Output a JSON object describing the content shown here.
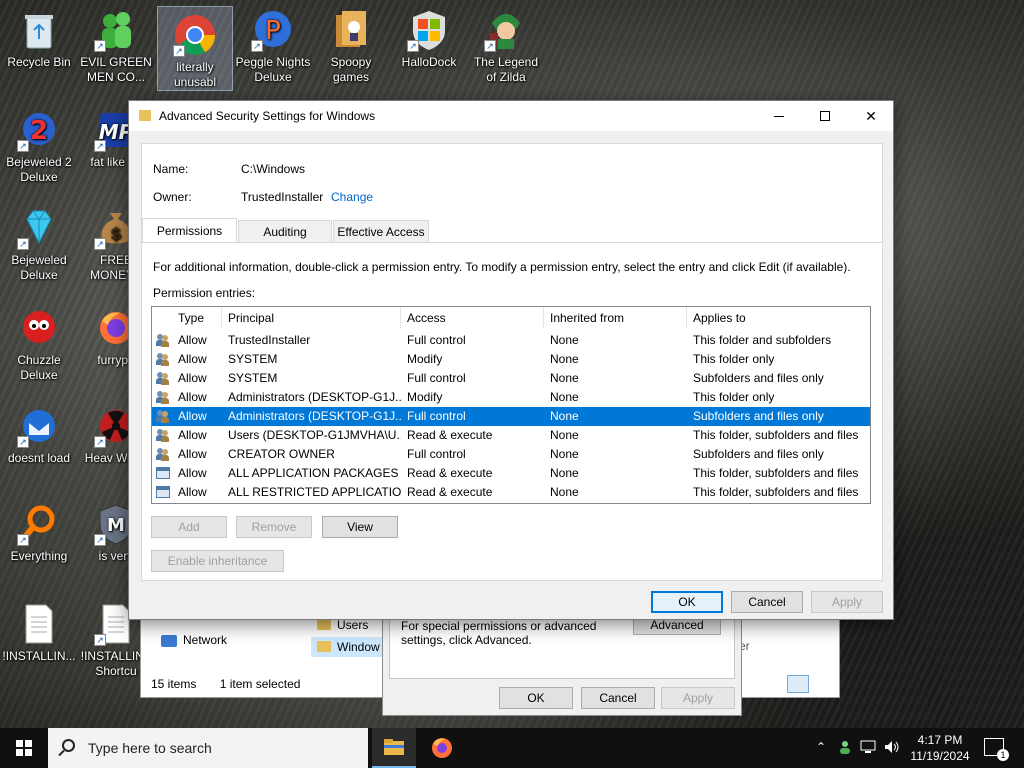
{
  "desktop": {
    "icons": [
      {
        "label": "Recycle Bin"
      },
      {
        "label": "EVIL GREEN MEN CO..."
      },
      {
        "label": "literally unusabl"
      },
      {
        "label": "Peggle Nights Deluxe"
      },
      {
        "label": "Spoopy games"
      },
      {
        "label": "HalloDock"
      },
      {
        "label": "The Legend of Zilda"
      },
      {
        "label": "Bejeweled 2 Deluxe"
      },
      {
        "label": "fat like da"
      },
      {
        "label": "Bejeweled Deluxe"
      },
      {
        "label": "FREE MONEY.c"
      },
      {
        "label": "Chuzzle Deluxe"
      },
      {
        "label": "furrypo"
      },
      {
        "label": "doesnt load"
      },
      {
        "label": "Heav Weap"
      },
      {
        "label": "Everything"
      },
      {
        "label": "is very"
      },
      {
        "label": "!INSTALLIN..."
      },
      {
        "label": "!INSTALLIN - Shortcu"
      }
    ]
  },
  "explorer": {
    "nav_network": "Network",
    "rows": [
      "Users",
      "Window"
    ],
    "status_items": "15 items",
    "status_selected": "1 item selected",
    "partial_text": "er"
  },
  "dialog2": {
    "note": "For special permissions or advanced settings, click Advanced.",
    "advanced_label": "Advanced",
    "ok_label": "OK",
    "cancel_label": "Cancel",
    "apply_label": "Apply"
  },
  "main": {
    "title": "Advanced Security Settings for Windows",
    "name_label": "Name:",
    "name_value": "C:\\Windows",
    "owner_label": "Owner:",
    "owner_value": "TrustedInstaller",
    "change_label": "Change",
    "tabs": [
      {
        "label": "Permissions"
      },
      {
        "label": "Auditing"
      },
      {
        "label": "Effective Access"
      }
    ],
    "hint": "For additional information, double-click a permission entry. To modify a permission entry, select the entry and click Edit (if available).",
    "entries_label": "Permission entries:",
    "columns": {
      "type": "Type",
      "principal": "Principal",
      "access": "Access",
      "inherited": "Inherited from",
      "applies": "Applies to"
    },
    "rows": [
      {
        "type": "Allow",
        "principal": "TrustedInstaller",
        "access": "Full control",
        "inherited": "None",
        "applies": "This folder and subfolders"
      },
      {
        "type": "Allow",
        "principal": "SYSTEM",
        "access": "Modify",
        "inherited": "None",
        "applies": "This folder only"
      },
      {
        "type": "Allow",
        "principal": "SYSTEM",
        "access": "Full control",
        "inherited": "None",
        "applies": "Subfolders and files only"
      },
      {
        "type": "Allow",
        "principal": "Administrators (DESKTOP-G1J...",
        "access": "Modify",
        "inherited": "None",
        "applies": "This folder only"
      },
      {
        "type": "Allow",
        "principal": "Administrators (DESKTOP-G1J...",
        "access": "Full control",
        "inherited": "None",
        "applies": "Subfolders and files only"
      },
      {
        "type": "Allow",
        "principal": "Users (DESKTOP-G1JMVHA\\U...",
        "access": "Read & execute",
        "inherited": "None",
        "applies": "This folder, subfolders and files"
      },
      {
        "type": "Allow",
        "principal": "CREATOR OWNER",
        "access": "Full control",
        "inherited": "None",
        "applies": "Subfolders and files only"
      },
      {
        "type": "Allow",
        "principal": "ALL APPLICATION PACKAGES",
        "access": "Read & execute",
        "inherited": "None",
        "applies": "This folder, subfolders and files"
      },
      {
        "type": "Allow",
        "principal": "ALL RESTRICTED APPLICATIO...",
        "access": "Read & execute",
        "inherited": "None",
        "applies": "This folder, subfolders and files"
      }
    ],
    "add_label": "Add",
    "remove_label": "Remove",
    "view_label": "View",
    "enable_inheritance_label": "Enable inheritance",
    "ok_label": "OK",
    "cancel_label": "Cancel",
    "apply_label": "Apply"
  },
  "taskbar": {
    "search_placeholder": "Type here to search",
    "time": "4:17 PM",
    "date": "11/19/2024",
    "notification_count": "1"
  },
  "colors": {
    "selection": "#0078d7",
    "link": "#0066cc"
  }
}
